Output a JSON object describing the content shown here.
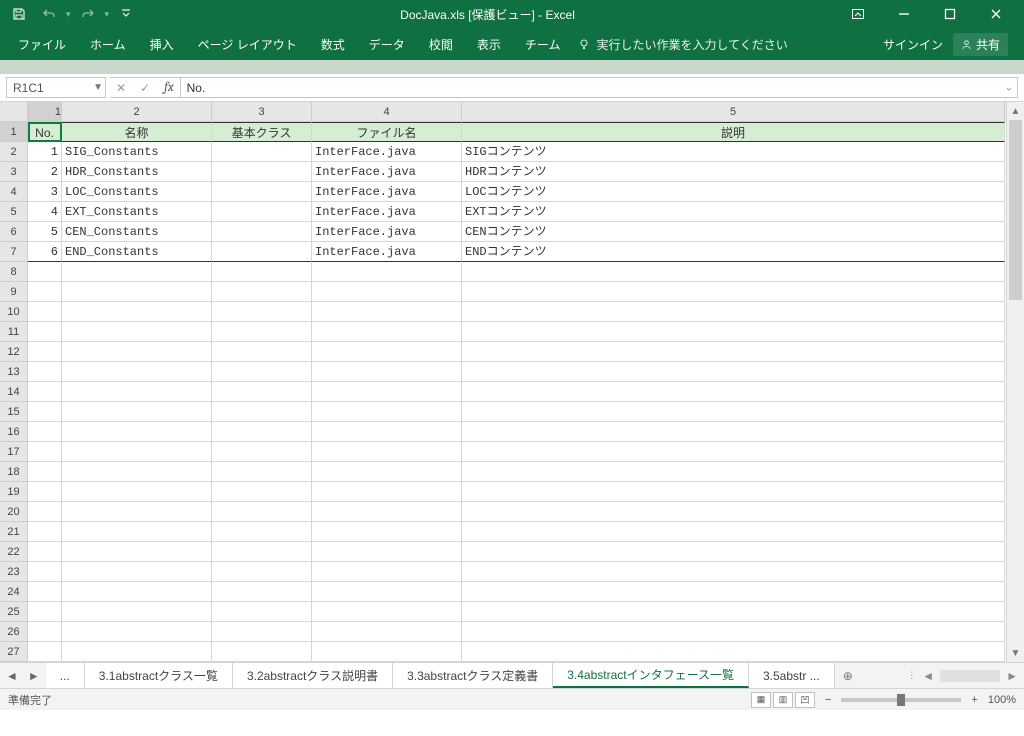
{
  "title": "DocJava.xls  [保護ビュー] - Excel",
  "qat": {
    "save": "save-icon",
    "undo": "undo-icon",
    "redo": "redo-icon",
    "customize": "chevron-down-icon"
  },
  "ribbon": {
    "tabs": [
      "ファイル",
      "ホーム",
      "挿入",
      "ページ レイアウト",
      "数式",
      "データ",
      "校閲",
      "表示",
      "チーム"
    ],
    "tell": "実行したい作業を入力してください",
    "signin": "サインイン",
    "share": "共有"
  },
  "namebox": "R1C1",
  "formula": "No.",
  "columns": [
    "1",
    "2",
    "3",
    "4",
    "5"
  ],
  "headers": [
    "No.",
    "名称",
    "基本クラス",
    "ファイル名",
    "説明"
  ],
  "rows": [
    {
      "no": "1",
      "name": "SIG_Constants",
      "base": "",
      "file": "InterFace.java",
      "desc": "SIGコンテンツ"
    },
    {
      "no": "2",
      "name": "HDR_Constants",
      "base": "",
      "file": "InterFace.java",
      "desc": "HDRコンテンツ"
    },
    {
      "no": "3",
      "name": "LOC_Constants",
      "base": "",
      "file": "InterFace.java",
      "desc": "LOCコンテンツ"
    },
    {
      "no": "4",
      "name": "EXT_Constants",
      "base": "",
      "file": "InterFace.java",
      "desc": "EXTコンテンツ"
    },
    {
      "no": "5",
      "name": "CEN_Constants",
      "base": "",
      "file": "InterFace.java",
      "desc": "CENコンテンツ"
    },
    {
      "no": "6",
      "name": "END_Constants",
      "base": "",
      "file": "InterFace.java",
      "desc": "ENDコンテンツ"
    }
  ],
  "row_labels_extra": [
    "8",
    "9",
    "10",
    "11",
    "12",
    "13",
    "14",
    "15",
    "16",
    "17",
    "18",
    "19",
    "20",
    "21",
    "22",
    "23",
    "24",
    "25",
    "26",
    "27"
  ],
  "sheets": [
    "...",
    "3.1abstractクラス一覧",
    "3.2abstractクラス説明書",
    "3.3abstractクラス定義書",
    "3.4abstractインタフェース一覧",
    "3.5abstr ..."
  ],
  "active_sheet": 4,
  "status": "準備完了",
  "zoom": "100%",
  "colors": {
    "brand": "#0f7041",
    "hdr": "#d5eed3"
  }
}
